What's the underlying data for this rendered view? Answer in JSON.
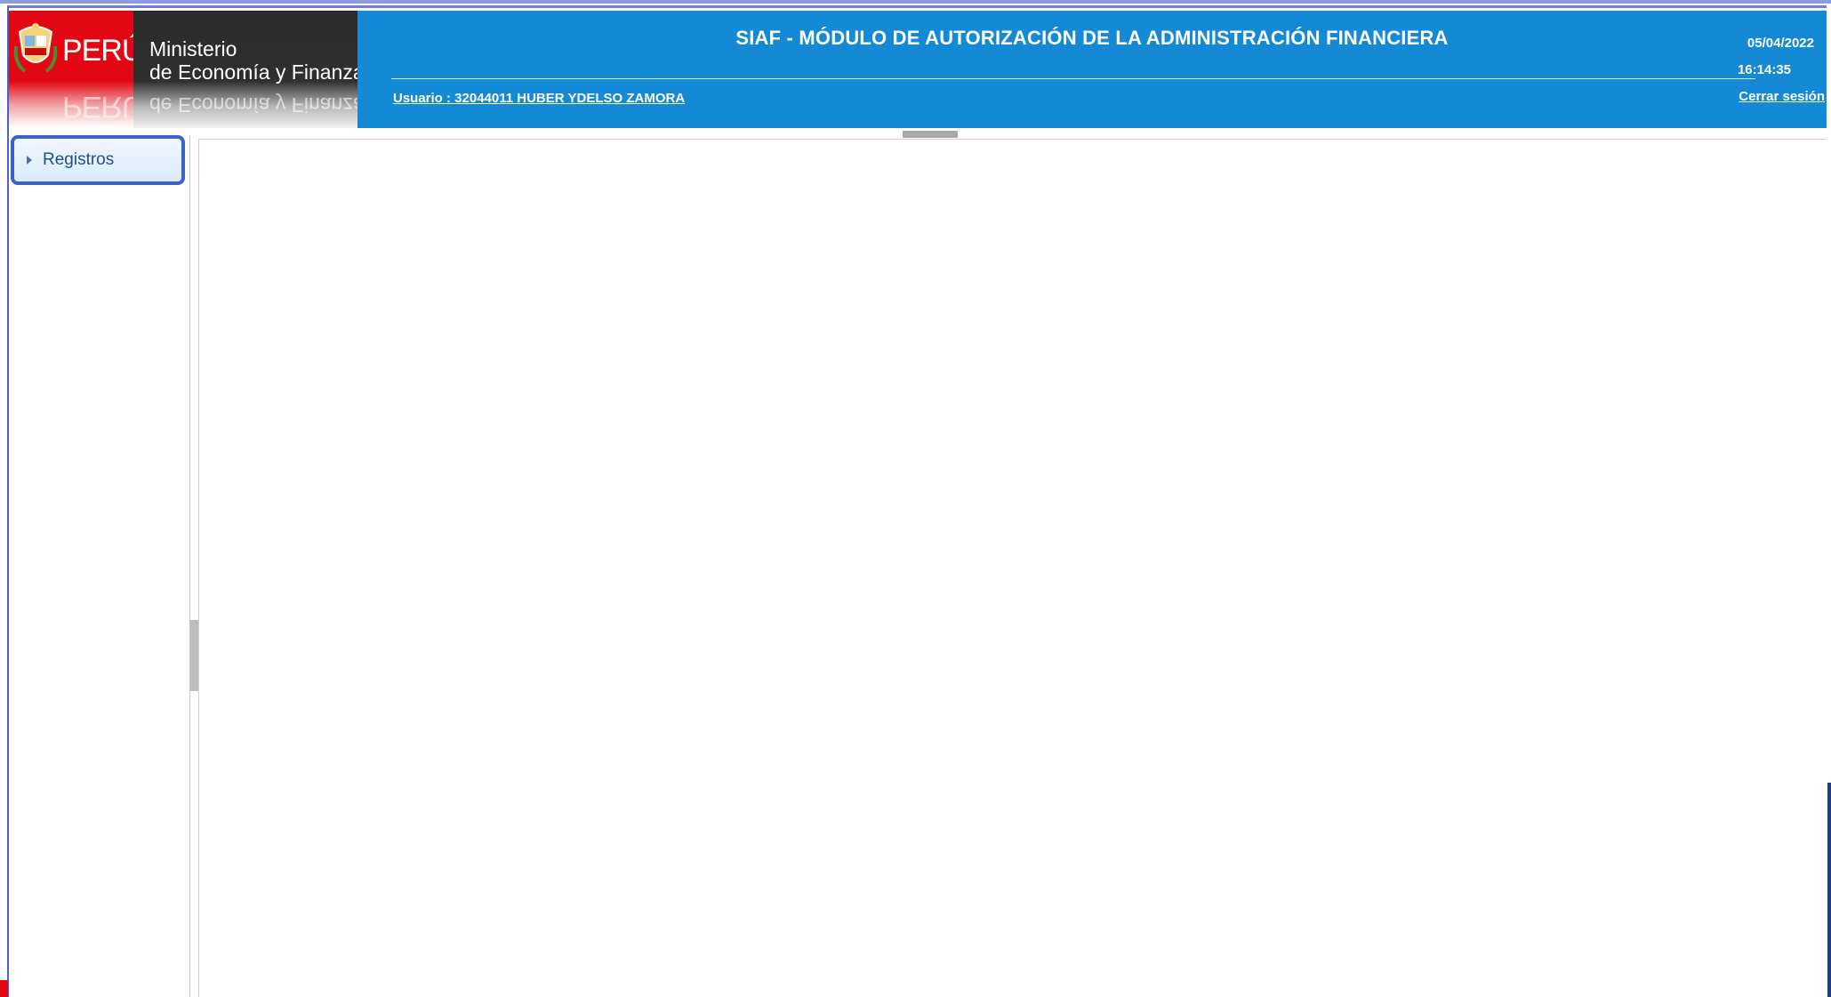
{
  "header": {
    "logo": {
      "country": "PERÚ",
      "ministry_line1": "Ministerio",
      "ministry_line2": "de Economía y Finanzas",
      "coat_of_arms_icon": "peru-coat-of-arms-icon"
    },
    "title": "SIAF - MÓDULO DE AUTORIZACIÓN DE LA ADMINISTRACIÓN FINANCIERA",
    "user_label": "Usuario : 32044011 HUBER YDELSO ZAMORA",
    "date": "05/04/2022",
    "time": "16:14:35",
    "logout_label": "Cerrar sesión"
  },
  "sidebar": {
    "items": [
      {
        "label": "Registros",
        "icon": "chevron-right-icon"
      }
    ]
  },
  "colors": {
    "banner_blue": "#1489d6",
    "brand_red": "#e30613",
    "selected_border": "#3c62c9"
  }
}
